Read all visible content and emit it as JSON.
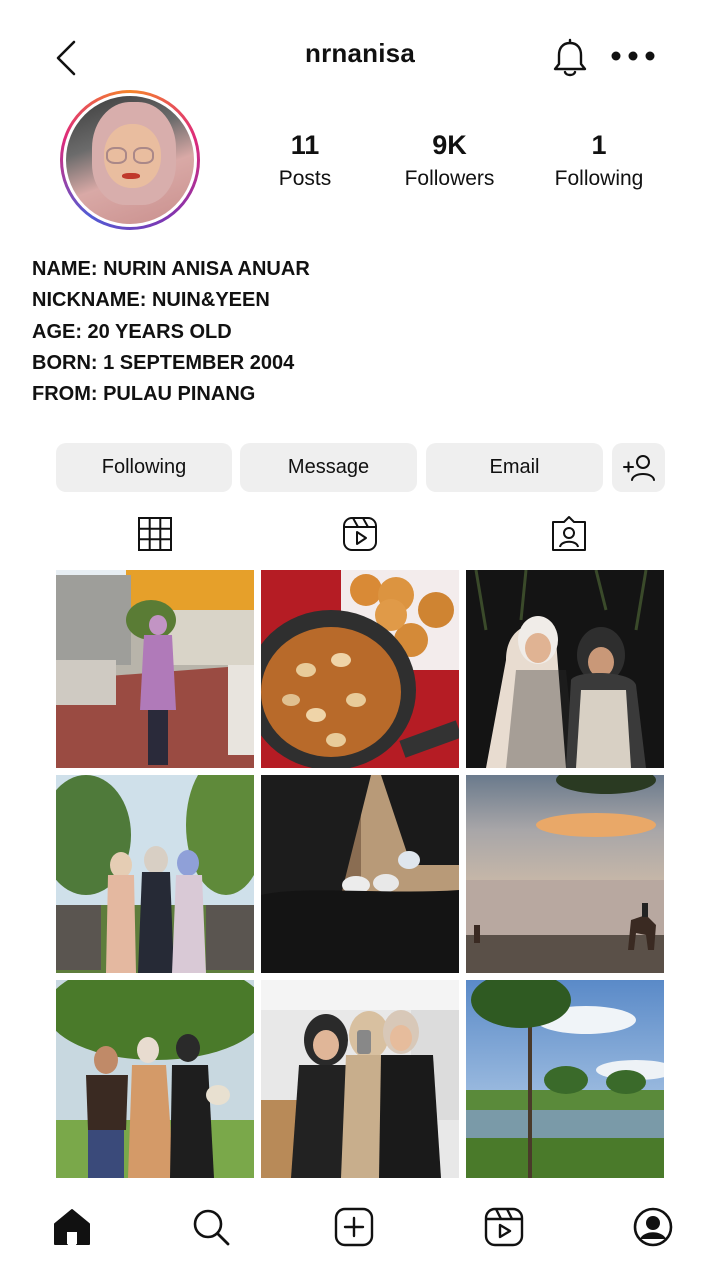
{
  "header": {
    "username": "nrnanisa"
  },
  "stats": {
    "posts": {
      "value": "11",
      "label": "Posts"
    },
    "followers": {
      "value": "9K",
      "label": "Followers"
    },
    "following": {
      "value": "1",
      "label": "Following"
    }
  },
  "bio": [
    "NAME: NURIN ANISA ANUAR",
    "NICKNAME: NUIN&YEEN",
    "AGE: 20 YEARS OLD",
    "BORN: 1 SEPTEMBER 2004",
    "FROM: PULAU PINANG"
  ],
  "actions": {
    "following": "Following",
    "message": "Message",
    "email": "Email"
  },
  "tabs": [
    "grid-icon",
    "reels-icon",
    "tagged-icon"
  ],
  "posts": [
    {
      "name": "post-woman-purple-dress"
    },
    {
      "name": "post-food-clams-pan"
    },
    {
      "name": "post-two-friends-night"
    },
    {
      "name": "post-three-friends-garden"
    },
    {
      "name": "post-shoes-floor"
    },
    {
      "name": "post-sunset-beach-horse"
    },
    {
      "name": "post-group-park"
    },
    {
      "name": "post-three-friends-selfie"
    },
    {
      "name": "post-lake-tree-park"
    }
  ],
  "bottom_nav": [
    "home-icon",
    "search-icon",
    "create-icon",
    "reels-icon",
    "profile-icon"
  ],
  "colors": {
    "button_bg": "#efefef",
    "text": "#111111"
  }
}
